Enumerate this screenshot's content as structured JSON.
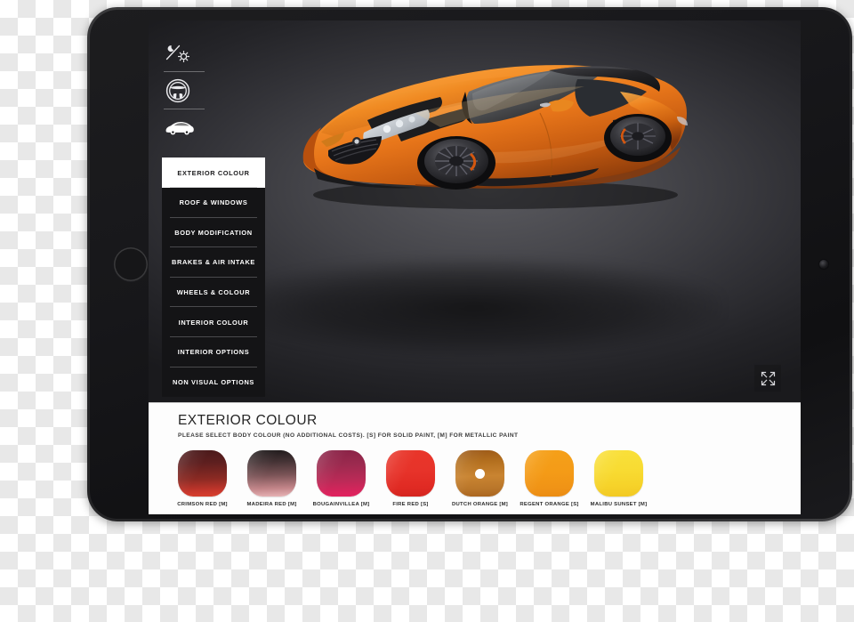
{
  "device": {
    "type": "tablet",
    "orientation": "landscape",
    "home_button": "home-button",
    "camera": "front-camera-lens"
  },
  "app": {
    "name": "Car Configurator",
    "view_mode": "exterior"
  },
  "icon_rail": {
    "items": [
      {
        "icon": "day-night-toggle-icon",
        "name": "lighting-toggle",
        "label": "Day / Night lighting",
        "active": false
      },
      {
        "icon": "steering-wheel-icon",
        "name": "interior-view",
        "label": "Interior view",
        "active": false
      },
      {
        "icon": "car-side-icon",
        "name": "exterior-view",
        "label": "Exterior view",
        "active": true
      }
    ]
  },
  "side_menu": {
    "items": [
      {
        "label": "EXTERIOR COLOUR",
        "active": true
      },
      {
        "label": "ROOF & WINDOWS",
        "active": false
      },
      {
        "label": "BODY MODIFICATION",
        "active": false
      },
      {
        "label": "BRAKES & AIR INTAKE",
        "active": false
      },
      {
        "label": "WHEELS & COLOUR",
        "active": false
      },
      {
        "label": "INTERIOR COLOUR",
        "active": false
      },
      {
        "label": "INTERIOR OPTIONS",
        "active": false
      },
      {
        "label": "NON VISUAL OPTIONS",
        "active": false
      }
    ]
  },
  "viewport": {
    "subject": "orange sports car with black roof",
    "background": "dark grey studio",
    "fullscreen_button": "expand-fullscreen"
  },
  "panel": {
    "title": "EXTERIOR COLOUR",
    "subtitle": "PLEASE SELECT BODY COLOUR (NO ADDITIONAL COSTS). [S] FOR SOLID PAINT, [M] FOR METALLIC PAINT",
    "swatches": [
      {
        "label": "CRIMSON RED [M]",
        "selected": false,
        "gradient": "linear-gradient(178deg,#4a1a1b 0%,#5e1f1f 28%,#8c2a23 62%,#c9372c 88%,#d9422f 100%)"
      },
      {
        "label": "MADEIRA RED [M]",
        "selected": false,
        "gradient": "linear-gradient(178deg,#1f1a1b 0%,#453335 26%,#7b5457 54%,#c4868a 82%,#e9b6b8 100%)"
      },
      {
        "label": "BOUGAINVILLEA [M]",
        "selected": false,
        "gradient": "linear-gradient(178deg,#8a2347 0%,#9c2a4f 32%,#bc2a57 66%,#d8245c 88%,#e32260 100%)"
      },
      {
        "label": "FIRE RED [S]",
        "selected": false,
        "gradient": "linear-gradient(178deg,#e8362a 0%,#e7332a 45%,#e02a23 80%,#d3251f 100%)"
      },
      {
        "label": "DUTCH ORANGE [M]",
        "selected": true,
        "gradient": "linear-gradient(178deg,#9d5a18 0%,#b4701f 26%,#c98431 56%,#b9762a 82%,#a9641f 100%)"
      },
      {
        "label": "REGENT ORANGE [S]",
        "selected": false,
        "gradient": "linear-gradient(178deg,#f5a019 0%,#f49b17 48%,#f09316 82%,#ea8b13 100%)"
      },
      {
        "label": "MALIBU SUNSET [M]",
        "selected": false,
        "gradient": "linear-gradient(178deg,#f9e03a 0%,#f8dc33 40%,#f6d32a 74%,#f2c924 100%)"
      }
    ]
  },
  "colors": {
    "panel_bg": "#fdfdfd",
    "menu_bg": "#141416",
    "menu_active_bg": "#ffffff",
    "screen_bg": "#131315",
    "text_light": "#ffffff",
    "text_dark": "#262626"
  }
}
